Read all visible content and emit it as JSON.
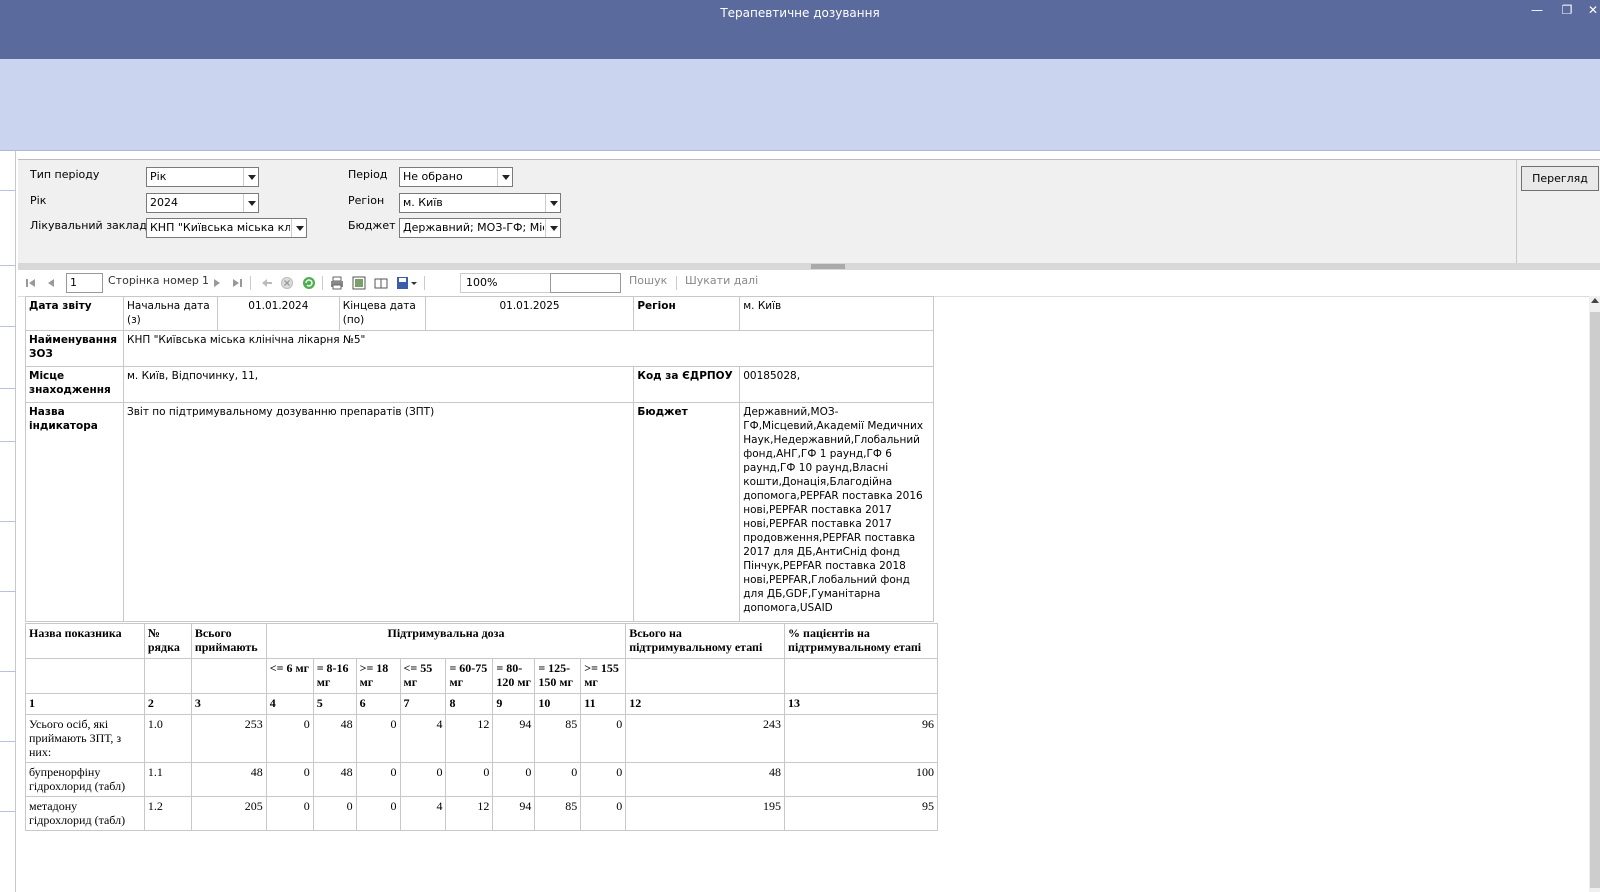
{
  "window": {
    "title": "Терапевтичне дозування"
  },
  "filters": {
    "period_type": {
      "label": "Тип періоду",
      "value": "Рік"
    },
    "year": {
      "label": "Рік",
      "value": "2024"
    },
    "facility": {
      "label": "Лікувальний заклад",
      "value": "КНП \"Київська міська клін"
    },
    "period": {
      "label": "Період",
      "value": "Не обрано"
    },
    "region": {
      "label": "Регіон",
      "value": "м. Київ"
    },
    "budget": {
      "label": "Бюджет",
      "value": "Державний; МОЗ-ГФ; Міс"
    },
    "view_button": "Перегляд"
  },
  "toolbar": {
    "page_input": "1",
    "page_label": "Сторінка номер",
    "page_total": "1",
    "zoom": "100%",
    "search_value": "",
    "search_label": "Пошук",
    "find_next_label": "Шукати далі"
  },
  "header_table": {
    "report_date_label": "Дата звіту",
    "start_date_label": "Начальна дата (з)",
    "start_date": "01.01.2024",
    "end_date_label": "Кінцева дата (по)",
    "end_date": "01.01.2025",
    "region_label": "Регіон",
    "region": "м. Київ",
    "facility_label": "Найменування ЗОЗ",
    "facility": "КНП \"Київська міська клінічна лікарня №5\"",
    "location_label": "Місце знаходження",
    "location": "м. Київ, Відпочинку, 11,",
    "edrpou_label": "Код за ЄДРПОУ",
    "edrpou": "00185028,",
    "indicator_label": "Назва індикатора",
    "indicator": "Звіт по підтримувальному дозуванню препаратів (ЗПТ)",
    "budget_label": "Бюджет",
    "budget": "Державний,МОЗ-ГФ,Місцевий,Академії Медичних Наук,Недержавний,Глобальний фонд,АНГ,ГФ 1 раунд,ГФ 6 раунд,ГФ 10 раунд,Власні кошти,Донація,Благодійна допомога,PEPFAR поставка 2016 нові,PEPFAR поставка 2017 нові,PEPFAR поставка 2017 продовження,PEPFAR поставка 2017 для ДБ,АнтиСнід фонд Пінчук,PEPFAR поставка 2018 нові,PEPFAR,Глобальний фонд для ДБ,GDF,Гуманітарна допомога,USAID"
  },
  "data_table": {
    "col_name": "Назва показника",
    "col_row": "№ рядка",
    "col_total": "Всього приймають",
    "col_dose": "Підтримувальна доза",
    "col_maint_total": "Всього на підтримувальному етапі",
    "col_percent": "% пацієнтів на підтримувальному етапі",
    "dose_ranges": [
      "<= 6 мг",
      "= 8-16 мг",
      ">= 18 мг",
      "<= 55 мг",
      "= 60-75 мг",
      "= 80-120 мг",
      "= 125-150 мг",
      ">= 155 мг"
    ],
    "col_numbers": [
      "1",
      "2",
      "3",
      "4",
      "5",
      "6",
      "7",
      "8",
      "9",
      "10",
      "11",
      "12",
      "13"
    ],
    "rows": [
      {
        "name": "Усього осіб, які приймають ЗПТ, з них:",
        "num": "1.0",
        "total": "253",
        "d": [
          "0",
          "48",
          "0",
          "4",
          "12",
          "94",
          "85",
          "0"
        ],
        "maint": "243",
        "pct": "96"
      },
      {
        "name": "бупренорфіну гідрохлорид (табл)",
        "num": "1.1",
        "total": "48",
        "d": [
          "0",
          "48",
          "0",
          "0",
          "0",
          "0",
          "0",
          "0"
        ],
        "maint": "48",
        "pct": "100"
      },
      {
        "name": "метадону гідрохлорид (табл)",
        "num": "1.2",
        "total": "205",
        "d": [
          "0",
          "0",
          "0",
          "4",
          "12",
          "94",
          "85",
          "0"
        ],
        "maint": "195",
        "pct": "95"
      }
    ]
  }
}
